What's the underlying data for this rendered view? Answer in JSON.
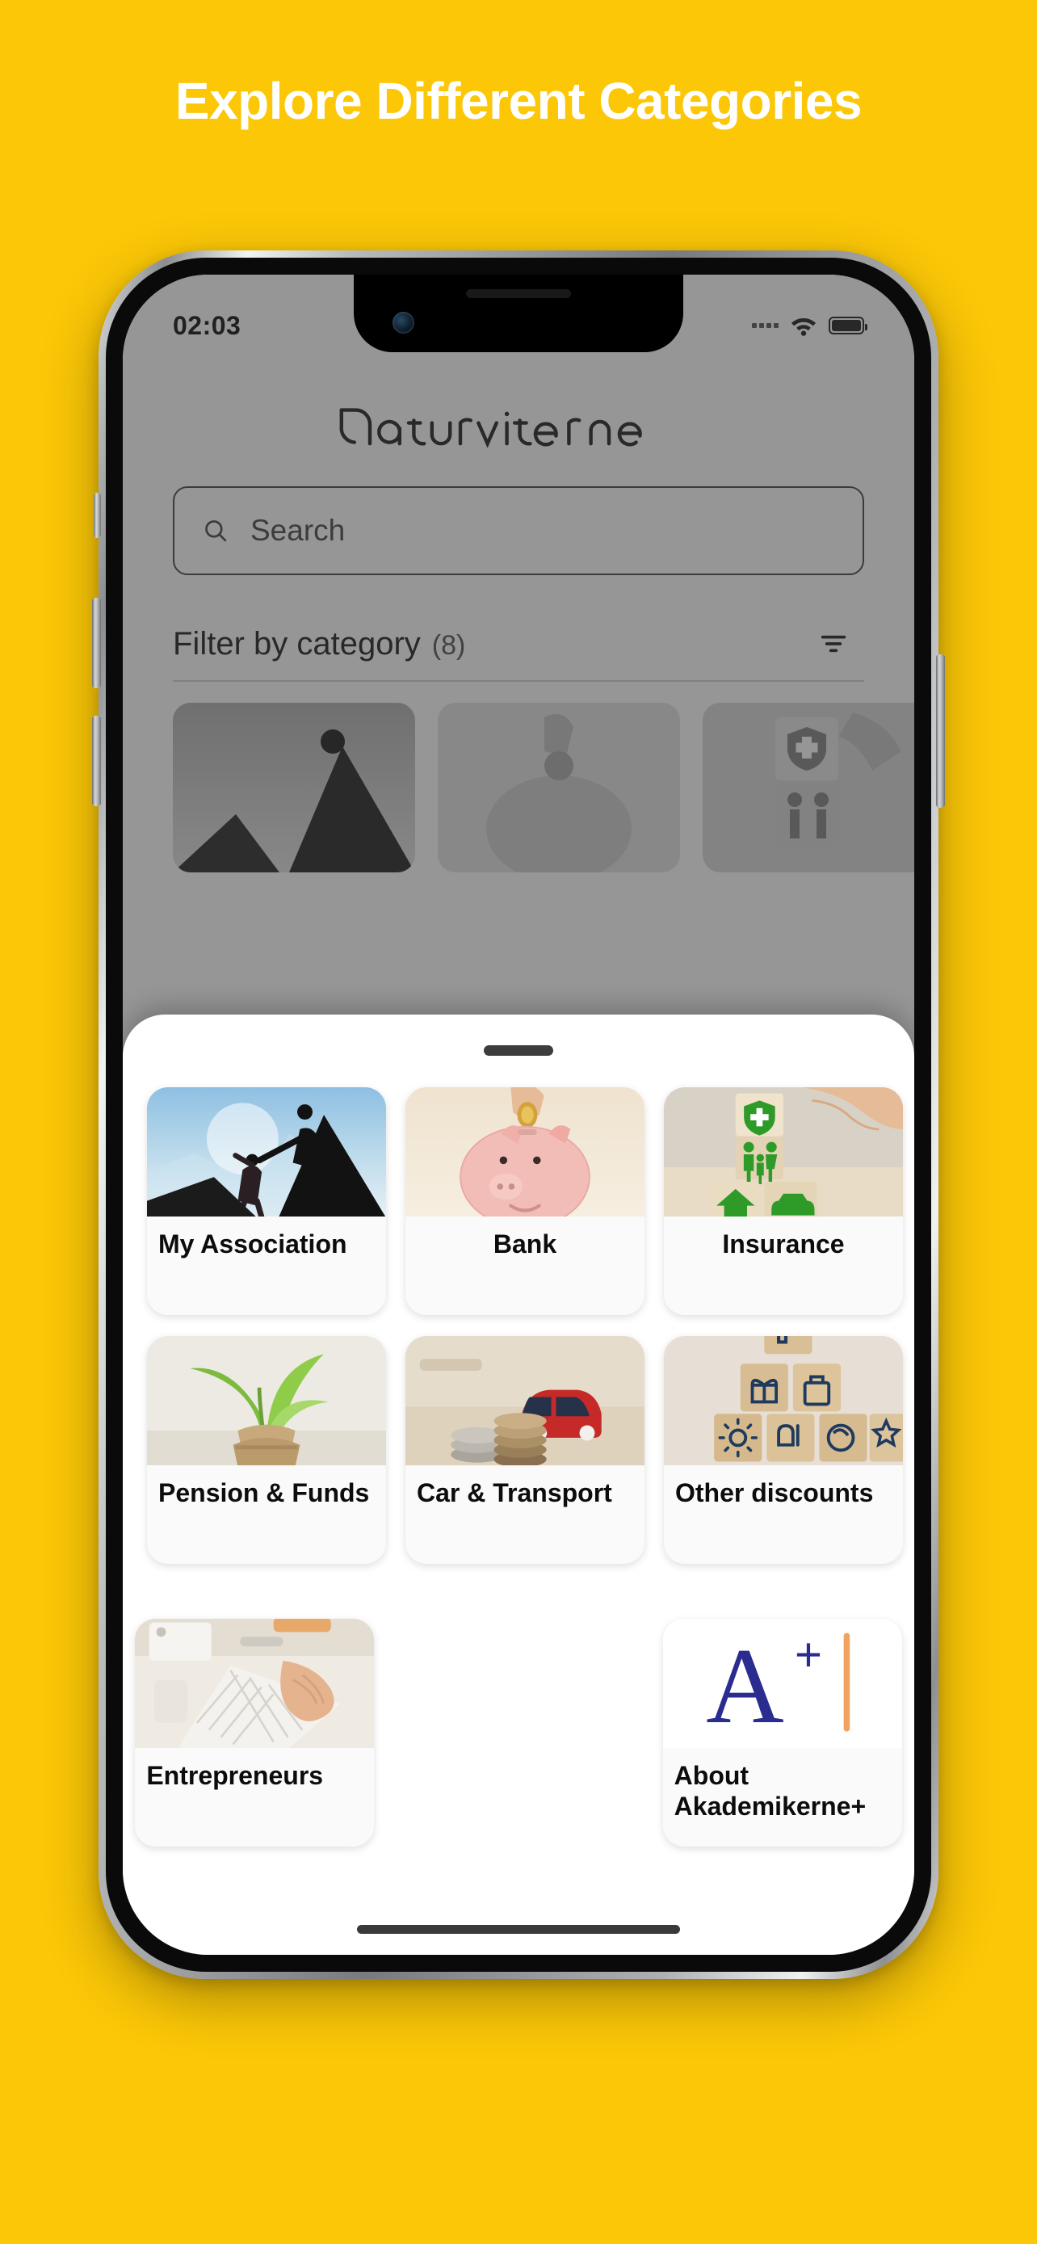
{
  "page": {
    "headline": "Explore Different Categories",
    "background_color": "#FBC707",
    "headline_color": "#FFFFFF"
  },
  "status_bar": {
    "time": "02:03",
    "signal_icon": "signal-dots-icon",
    "wifi_icon": "wifi-icon",
    "battery_icon": "battery-full-icon"
  },
  "app": {
    "brand_name": "naturviterne",
    "search": {
      "placeholder": "Search",
      "value": "",
      "icon": "search-icon"
    },
    "filter": {
      "label": "Filter by category",
      "count": "(8)",
      "icon": "filter-icon"
    }
  },
  "sheet": {
    "grabber": "drag-handle",
    "categories": [
      {
        "label": "My Association",
        "image": "climbers-helping-hand-photo",
        "align": "left"
      },
      {
        "label": "Bank",
        "image": "piggy-bank-coin-photo",
        "align": "center"
      },
      {
        "label": "Insurance",
        "image": "green-insurance-blocks-photo",
        "align": "center"
      },
      {
        "label": "Pension & Funds",
        "image": "plant-in-burlap-sack-photo",
        "align": "left"
      },
      {
        "label": "Car & Transport",
        "image": "red-toy-car-coins-photo",
        "align": "left"
      },
      {
        "label": "Other discounts",
        "image": "wooden-icon-blocks-photo",
        "align": "left"
      },
      {
        "label": "Entrepreneurs",
        "image": "hands-on-keyboard-photo",
        "align": "left"
      },
      {
        "label": "About Akademikerne+",
        "image": "akademikerne-plus-logo",
        "align": "left"
      }
    ]
  },
  "colors": {
    "accent_yellow": "#FBC707",
    "sheet_bg": "#FFFFFF",
    "card_bg": "#FAFAFA",
    "logo_navy": "#2A2C8F",
    "logo_orange": "#F0A35E",
    "insurance_green": "#2E9B28"
  }
}
